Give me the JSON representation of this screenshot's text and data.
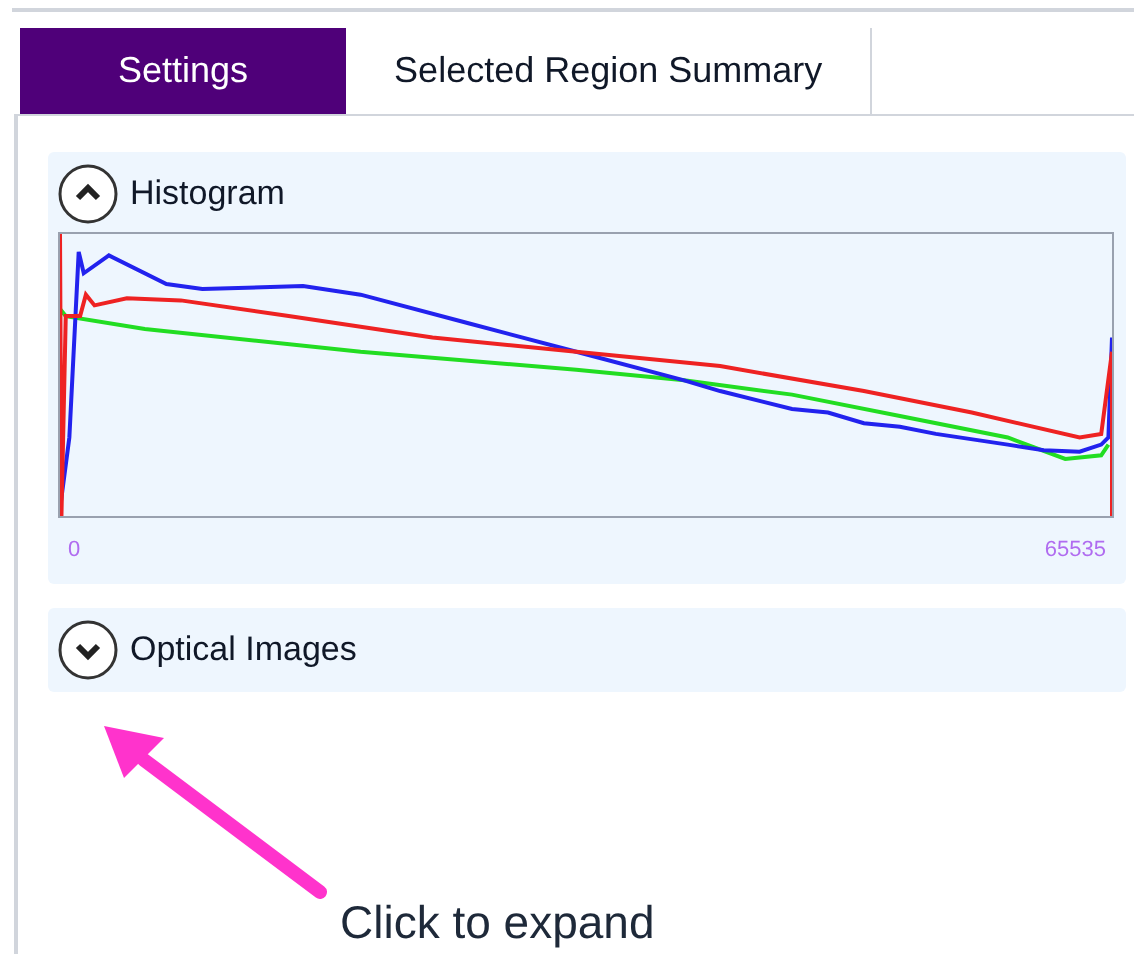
{
  "tabs": [
    {
      "label": "Settings",
      "selected": true
    },
    {
      "label": "Selected Region Summary",
      "selected": false
    }
  ],
  "sections": [
    {
      "title": "Histogram",
      "expanded": true,
      "axis_min": "0",
      "axis_max": "65535"
    },
    {
      "title": "Optical Images",
      "expanded": false
    }
  ],
  "annotation": {
    "text": "Click to expand"
  }
}
